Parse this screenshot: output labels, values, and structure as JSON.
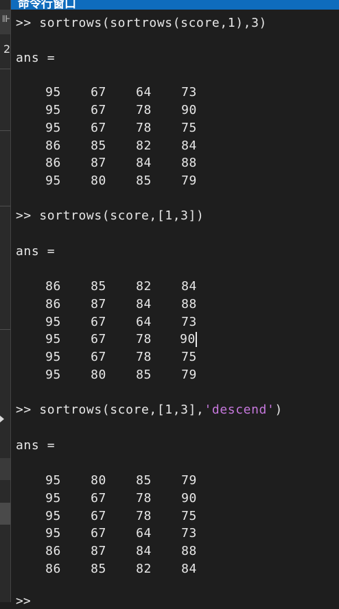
{
  "window": {
    "title": "命令行窗口"
  },
  "sidebar": {
    "row_number": "2"
  },
  "blocks": [
    {
      "command": "sortrows(sortrows(score,1),3)",
      "ans_label": "ans =",
      "rows": [
        [
          "95",
          "67",
          "64",
          "73"
        ],
        [
          "95",
          "67",
          "78",
          "90"
        ],
        [
          "95",
          "67",
          "78",
          "75"
        ],
        [
          "86",
          "85",
          "82",
          "84"
        ],
        [
          "86",
          "87",
          "84",
          "88"
        ],
        [
          "95",
          "80",
          "85",
          "79"
        ]
      ]
    },
    {
      "command": "sortrows(score,[1,3])",
      "ans_label": "ans =",
      "rows": [
        [
          "86",
          "85",
          "82",
          "84"
        ],
        [
          "86",
          "87",
          "84",
          "88"
        ],
        [
          "95",
          "67",
          "64",
          "73"
        ],
        [
          "95",
          "67",
          "78",
          "90"
        ],
        [
          "95",
          "67",
          "78",
          "75"
        ],
        [
          "95",
          "80",
          "85",
          "79"
        ]
      ]
    },
    {
      "command_prefix": "sortrows(score,[1,3],",
      "command_string": "'descend'",
      "command_suffix": ")",
      "ans_label": "ans =",
      "rows": [
        [
          "95",
          "80",
          "85",
          "79"
        ],
        [
          "95",
          "67",
          "78",
          "90"
        ],
        [
          "95",
          "67",
          "78",
          "75"
        ],
        [
          "95",
          "67",
          "64",
          "73"
        ],
        [
          "86",
          "87",
          "84",
          "88"
        ],
        [
          "86",
          "85",
          "82",
          "84"
        ]
      ]
    }
  ],
  "prompt": ">>",
  "colors": {
    "titlebar": "#0f6cbd",
    "background": "#1e1e1e",
    "text": "#e8e8e8",
    "string": "#c678dd"
  }
}
